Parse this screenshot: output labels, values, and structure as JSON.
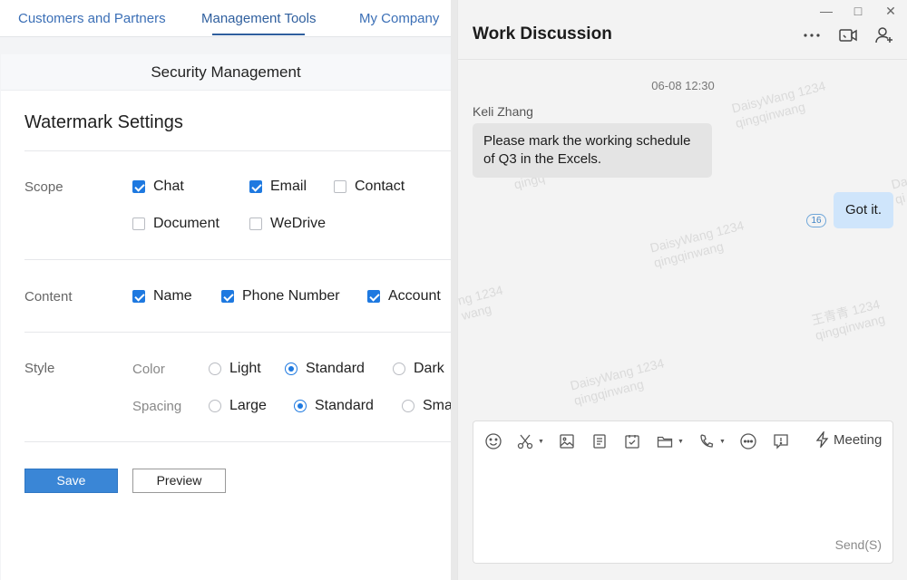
{
  "admin": {
    "nav_tabs": [
      {
        "label": "Customers and Partners"
      },
      {
        "label": "Management Tools",
        "active": true
      },
      {
        "label": "My Company"
      }
    ],
    "section_title": "Security Management",
    "watermark_title": "Watermark Settings",
    "scope": {
      "label": "Scope",
      "options": [
        {
          "label": "Chat",
          "checked": true
        },
        {
          "label": "Email",
          "checked": true
        },
        {
          "label": "Contact",
          "checked": false
        },
        {
          "label": "Document",
          "checked": false
        },
        {
          "label": "WeDrive",
          "checked": false
        }
      ]
    },
    "content": {
      "label": "Content",
      "options": [
        {
          "label": "Name",
          "checked": true
        },
        {
          "label": "Phone Number",
          "checked": true
        },
        {
          "label": "Account",
          "checked": true
        }
      ]
    },
    "style": {
      "label": "Style",
      "color": {
        "label": "Color",
        "options": [
          {
            "label": "Light",
            "selected": false
          },
          {
            "label": "Standard",
            "selected": true
          },
          {
            "label": "Dark",
            "selected": false
          }
        ]
      },
      "spacing": {
        "label": "Spacing",
        "options": [
          {
            "label": "Large",
            "selected": false
          },
          {
            "label": "Standard",
            "selected": true
          },
          {
            "label": "Sma",
            "selected": false
          }
        ]
      }
    },
    "buttons": {
      "save": "Save",
      "preview": "Preview"
    }
  },
  "chat": {
    "title": "Work Discussion",
    "window_controls": {
      "minimize": "—",
      "maximize": "□",
      "close": "✕"
    },
    "header_icons": [
      "more-icon",
      "video-call-icon",
      "add-member-icon"
    ],
    "timestamp": "06-08 12:30",
    "messages": [
      {
        "sender": "Keli Zhang",
        "text": "Please mark the working schedule of Q3 in the Excels.",
        "direction": "incoming"
      },
      {
        "text": "Got it.",
        "direction": "outgoing",
        "read_count": "16"
      }
    ],
    "watermarks": [
      {
        "line1": "DaisyWang 1234",
        "line2": "qingqinwang"
      },
      {
        "line1": "DaisyWang 1234",
        "line2": "qingqinwang"
      },
      {
        "line1": "王青青 1234",
        "line2": "qingqinwang"
      },
      {
        "line1": "DaisyWang 1234",
        "line2": "qingqinwang"
      },
      {
        "line1": "ng 1234",
        "line2": "wang"
      },
      {
        "line1": "Da",
        "line2": "qi"
      },
      {
        "line1": "qingq",
        "line2": ""
      }
    ],
    "toolbar_icons": [
      "emoji-icon",
      "screenshot-icon",
      "image-icon",
      "document-icon",
      "task-icon",
      "folder-icon",
      "phone-icon",
      "more-apps-icon",
      "reminder-icon"
    ],
    "meeting_label": "Meeting",
    "send_label": "Send(S)",
    "colors": {
      "accent": "#1e79e0",
      "outgoing_bubble": "#cfe5fb",
      "incoming_bubble": "#e4e4e4",
      "save_button": "#3a86d6"
    }
  }
}
